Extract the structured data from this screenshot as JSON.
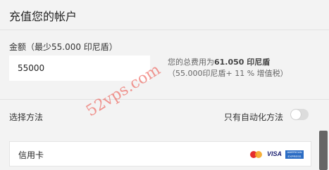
{
  "header": {
    "title": "充值您的帐户"
  },
  "amount": {
    "label": "金额（最少55.000 印尼盾）",
    "value": "55000",
    "total_prefix": "您的总费用为",
    "total_value": "61.050 印尼盾",
    "total_breakdown": "（55.000印尼盾+ 11 % 增值税）"
  },
  "methods": {
    "section_label": "选择方法",
    "auto_only_label": "只有自动化方法",
    "auto_only_enabled": false,
    "options": [
      {
        "label": "信用卡",
        "brands": [
          "mastercard-logo",
          "visa-logo",
          "amex-logo"
        ],
        "visa_text": "VISA",
        "amex_text": "AMERICAN EXPRESS"
      }
    ]
  },
  "watermark": {
    "text": "52vps.com"
  },
  "colors": {
    "background": "#f3f3f3",
    "watermark": "#eb463c",
    "toggle_off": "#dcdcdc"
  }
}
